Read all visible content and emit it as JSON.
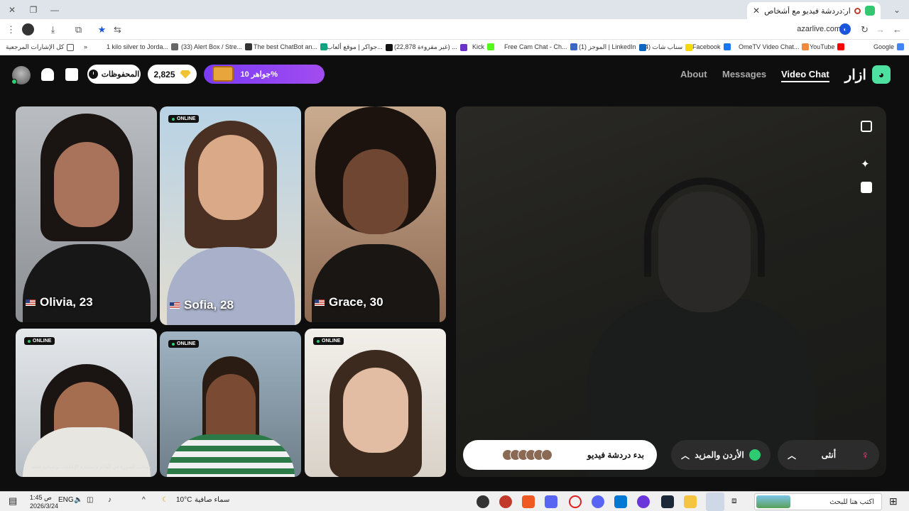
{
  "browser": {
    "tab_title": "أزار:دردشة فيديو مع أشخاص...",
    "url": "azarlive.com",
    "bookmarks": [
      {
        "label": "Google",
        "color": "#4285f4"
      },
      {
        "label": "YouTube",
        "color": "#ff0000"
      },
      {
        "label": "OmeTV Video Chat...",
        "color": "#f08a3c"
      },
      {
        "label": "Facebook",
        "color": "#1877f2"
      },
      {
        "label": "(4) سناب شات",
        "color": "#f5d90a"
      },
      {
        "label": "(1) الموجز | LinkedIn",
        "color": "#0a66c2"
      },
      {
        "label": "Free Cam Chat - Ch...",
        "color": "#3c67c4"
      },
      {
        "label": "Kick",
        "color": "#53fc18"
      },
      {
        "label": "(22,878 غير مقروءة) ...",
        "color": "#6a32c9"
      },
      {
        "label": "جواكر | موقع ألعاب ا...",
        "color": "#111111"
      },
      {
        "label": "The best ChatBot an...",
        "color": "#10a37f"
      },
      {
        "label": "(33) Alert Box / Stre...",
        "color": "#333333"
      },
      {
        "label": "1 kilo silver to Jorda...",
        "color": "#666666"
      }
    ],
    "all_bookmarks": "كل الإشارات المرجعية"
  },
  "app": {
    "logo_text": "ازار",
    "nav": {
      "video_chat": "Video Chat",
      "messages": "Messages",
      "about": "About"
    },
    "promo_label": "جواهر 10%",
    "gems_count": "2,825",
    "saved_label": "المحفوظات"
  },
  "profiles": [
    {
      "name": "Olivia, 23",
      "online": false
    },
    {
      "name": "Sofia, 28",
      "online": true
    },
    {
      "name": "Grace, 30",
      "online": false
    },
    {
      "name": "",
      "online": true,
      "caption": "بسحب الصورة في العالم واستخدم الإعلانات توضيحية فقط"
    },
    {
      "name": "",
      "online": true
    },
    {
      "name": "",
      "online": true
    }
  ],
  "online_label": "ONLINE",
  "controls": {
    "start_label": "بدء دردشة فيديو",
    "country_label": "الأردن والمزيد",
    "gender_label": "أنثى"
  },
  "taskbar": {
    "search_placeholder": "اكتب هنا للبحث",
    "weather_temp": "10°C",
    "weather_text": "سماء صافية",
    "lang": "ENG",
    "time": "1:45 ص",
    "date": "2026/3/24"
  }
}
